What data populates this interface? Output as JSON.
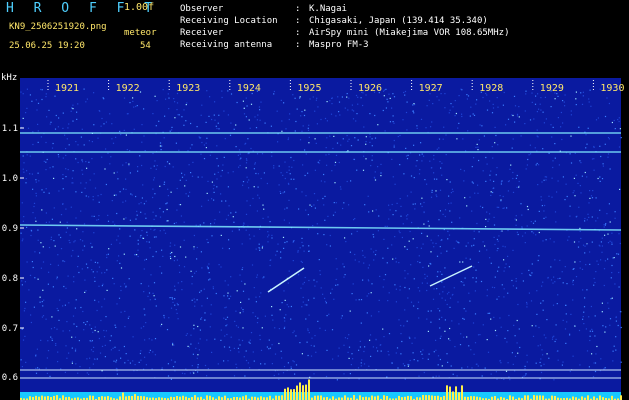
{
  "header": {
    "logo": "H R O F F T",
    "version": "1.00f",
    "filename": "KN9_2506251920.png",
    "meteor_label": "meteor",
    "datetime": "25.06.25 19:20",
    "meteor_count": "54",
    "info": [
      {
        "key": "Observer",
        "value": "K.Nagai"
      },
      {
        "key": "Receiving Location",
        "value": "Chigasaki, Japan (139.414 35.340)"
      },
      {
        "key": "Receiver",
        "value": "AirSpy mini (Miakejima VOR 108.65MHz)"
      },
      {
        "key": "Receiving antenna",
        "value": "Maspro FM-3"
      }
    ]
  },
  "axis": {
    "y_unit": "kHz",
    "y_labels": [
      "1.1",
      "1.0",
      "0.9",
      "0.8",
      "0.7",
      "0.6"
    ],
    "x_labels": [
      "1921",
      "1922",
      "1923",
      "1924",
      "1925",
      "1926",
      "1927",
      "1928",
      "1929",
      "1930"
    ]
  },
  "colors": {
    "background": "#000000",
    "plot_bg": "#0a1aa0",
    "noise": "#3a7cff",
    "signal": "#7fe8ff",
    "baseline": "#19c8ff",
    "spike": "#ffef4a",
    "label": "#ffe76a",
    "logo": "#4fd0ff"
  }
}
